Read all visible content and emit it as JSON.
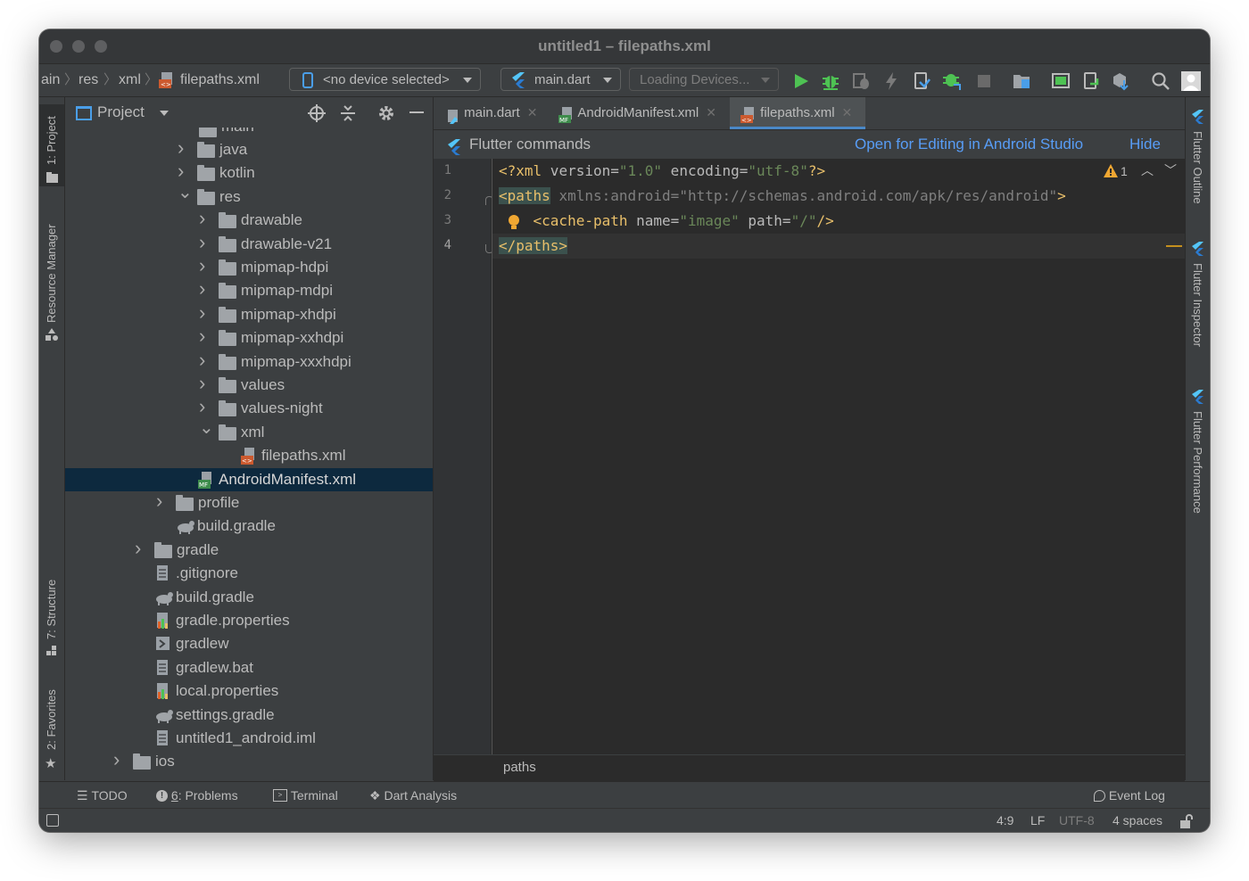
{
  "window": {
    "title": "untitled1 – filepaths.xml"
  },
  "breadcrumb": [
    "ain",
    "res",
    "xml",
    "filepaths.xml"
  ],
  "toolbar": {
    "device_selector": "<no device selected>",
    "run_config": "main.dart",
    "loading_devices": "Loading Devices..."
  },
  "left_strip": {
    "project": "1: Project",
    "resource_manager": "Resource Manager",
    "structure": "7: Structure",
    "favorites": "2: Favorites"
  },
  "right_strip": {
    "outline": "Flutter Outline",
    "inspector": "Flutter Inspector",
    "performance": "Flutter Performance"
  },
  "project_panel": {
    "title": "Project",
    "top_partial": "main",
    "tree": [
      {
        "label": "java",
        "depth": 5,
        "kind": "folder",
        "chevron": "right"
      },
      {
        "label": "kotlin",
        "depth": 5,
        "kind": "folder",
        "chevron": "right"
      },
      {
        "label": "res",
        "depth": 5,
        "kind": "folder",
        "chevron": "down"
      },
      {
        "label": "drawable",
        "depth": 6,
        "kind": "folder",
        "chevron": "right"
      },
      {
        "label": "drawable-v21",
        "depth": 6,
        "kind": "folder",
        "chevron": "right"
      },
      {
        "label": "mipmap-hdpi",
        "depth": 6,
        "kind": "folder",
        "chevron": "right"
      },
      {
        "label": "mipmap-mdpi",
        "depth": 6,
        "kind": "folder",
        "chevron": "right"
      },
      {
        "label": "mipmap-xhdpi",
        "depth": 6,
        "kind": "folder",
        "chevron": "right"
      },
      {
        "label": "mipmap-xxhdpi",
        "depth": 6,
        "kind": "folder",
        "chevron": "right"
      },
      {
        "label": "mipmap-xxxhdpi",
        "depth": 6,
        "kind": "folder",
        "chevron": "right"
      },
      {
        "label": "values",
        "depth": 6,
        "kind": "folder",
        "chevron": "right"
      },
      {
        "label": "values-night",
        "depth": 6,
        "kind": "folder",
        "chevron": "right"
      },
      {
        "label": "xml",
        "depth": 6,
        "kind": "folder",
        "chevron": "down"
      },
      {
        "label": "filepaths.xml",
        "depth": 7,
        "kind": "xml",
        "chevron": ""
      },
      {
        "label": "AndroidManifest.xml",
        "depth": 5,
        "kind": "manifest",
        "chevron": "",
        "selected": true
      },
      {
        "label": "profile",
        "depth": 4,
        "kind": "folder",
        "chevron": "right"
      },
      {
        "label": "build.gradle",
        "depth": 4,
        "kind": "gradle",
        "chevron": ""
      },
      {
        "label": "gradle",
        "depth": 3,
        "kind": "folder",
        "chevron": "right"
      },
      {
        "label": ".gitignore",
        "depth": 3,
        "kind": "file",
        "chevron": ""
      },
      {
        "label": "build.gradle",
        "depth": 3,
        "kind": "gradle",
        "chevron": ""
      },
      {
        "label": "gradle.properties",
        "depth": 3,
        "kind": "props",
        "chevron": ""
      },
      {
        "label": "gradlew",
        "depth": 3,
        "kind": "exec",
        "chevron": ""
      },
      {
        "label": "gradlew.bat",
        "depth": 3,
        "kind": "file",
        "chevron": ""
      },
      {
        "label": "local.properties",
        "depth": 3,
        "kind": "props",
        "chevron": ""
      },
      {
        "label": "settings.gradle",
        "depth": 3,
        "kind": "gradle",
        "chevron": ""
      },
      {
        "label": "untitled1_android.iml",
        "depth": 3,
        "kind": "file",
        "chevron": ""
      },
      {
        "label": "ios",
        "depth": 2,
        "kind": "folder",
        "chevron": "right"
      }
    ]
  },
  "editor": {
    "tabs": [
      {
        "label": "main.dart",
        "active": false
      },
      {
        "label": "AndroidManifest.xml",
        "active": false
      },
      {
        "label": "filepaths.xml",
        "active": true
      }
    ],
    "banner": {
      "title": "Flutter commands",
      "open_link": "Open for Editing in Android Studio",
      "hide_link": "Hide"
    },
    "line_numbers": [
      "1",
      "2",
      "3",
      "4"
    ],
    "warning_count": "1",
    "breadcrumb": "paths"
  },
  "bottom_bar": {
    "todo": "TODO",
    "problems_prefix": "6",
    "problems": ": Problems",
    "terminal": "Terminal",
    "dart_analysis": "Dart Analysis",
    "event_log": "Event Log"
  },
  "status_bar": {
    "position": "4:9",
    "line_sep": "LF",
    "encoding": "UTF-8",
    "indent": "4 spaces"
  },
  "colors": {
    "accent": "#4a88c7",
    "selection": "#0d293e",
    "run_green": "#4ec253",
    "xml_tag": "#e8bf6a",
    "xml_attr": "#bababa",
    "xml_value": "#6a8759"
  }
}
